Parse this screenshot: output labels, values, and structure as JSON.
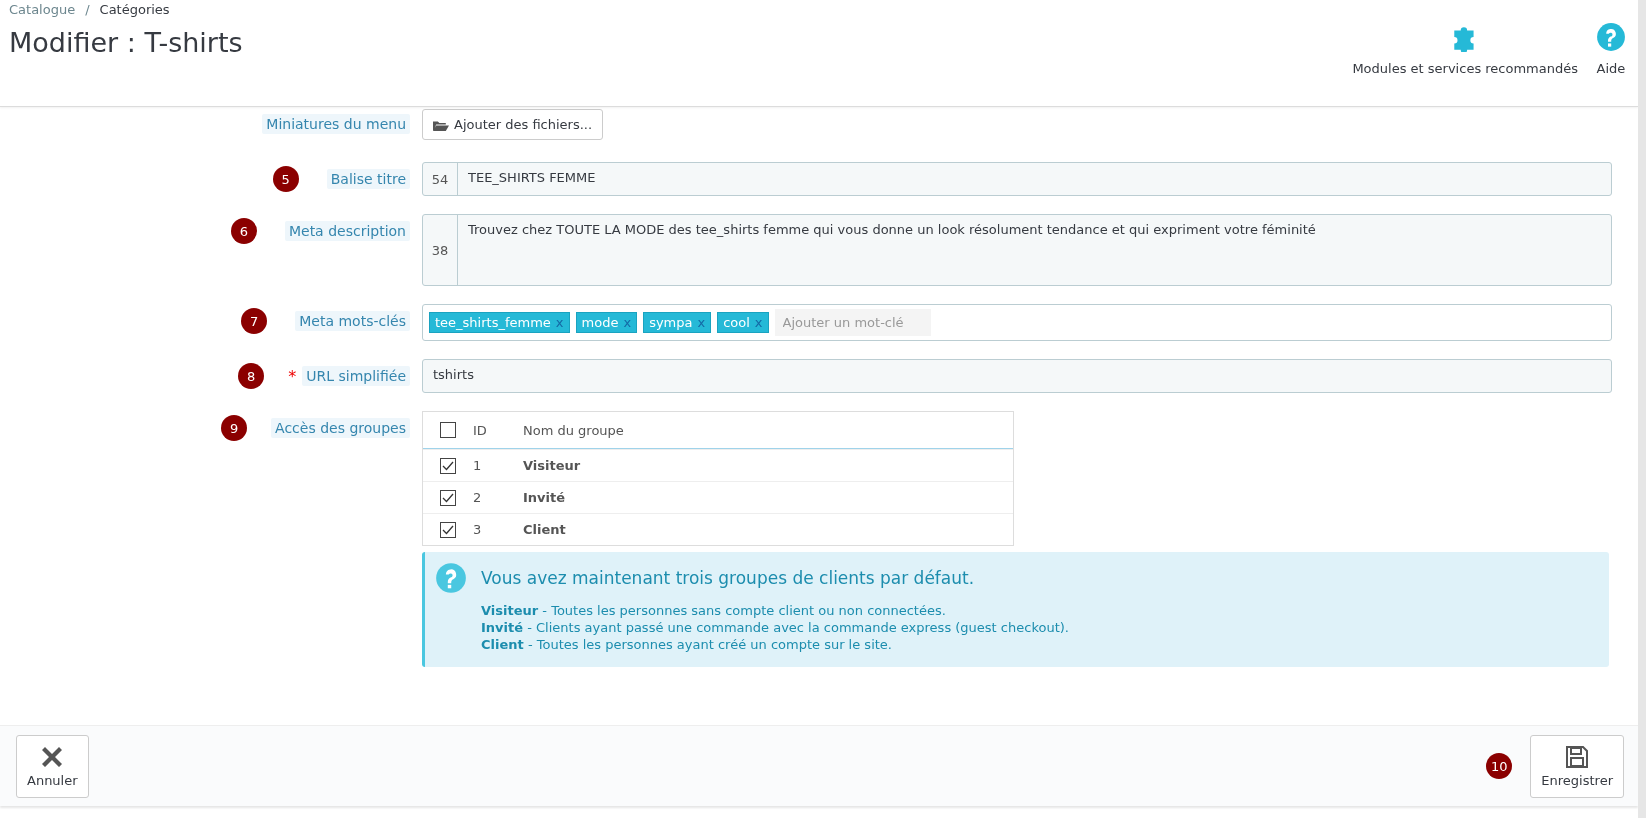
{
  "breadcrumb": [
    "Catalogue",
    "Catégories"
  ],
  "breadcrumb_separator": "/",
  "title": "Modifier : T-shirts",
  "toolbar": [
    {
      "kind": "modules",
      "label": "Modules et services recommandés"
    },
    {
      "kind": "help",
      "label": "Aide"
    }
  ],
  "form": [
    {
      "kind": "file",
      "label": "Miniatures du menu",
      "button": "Ajouter des fichiers..."
    },
    {
      "kind": "counted",
      "step": "5",
      "label": "Balise titre",
      "counter": "54",
      "value": "TEE_SHIRTS FEMME"
    },
    {
      "kind": "area",
      "step": "6",
      "label": "Meta description",
      "counter": "38",
      "value": "Trouvez chez TOUTE LA MODE des tee_shirts femme qui vous donne un look résolument tendance et qui expriment votre féminité"
    },
    {
      "kind": "tags",
      "step": "7",
      "label": "Meta mots-clés",
      "tags": [
        {
          "text": "tee_shirts_femme",
          "remove": "x"
        },
        {
          "text": "mode",
          "remove": "x"
        },
        {
          "text": "sympa",
          "remove": "x"
        },
        {
          "text": "cool",
          "remove": "x"
        }
      ],
      "placeholder": "Ajouter un mot-clé"
    },
    {
      "kind": "text",
      "step": "8",
      "required_mark": "*",
      "label": "URL simplifiée",
      "value": "tshirts"
    },
    {
      "kind": "groups",
      "step": "9",
      "label": "Accès des groupes",
      "all_checked": false,
      "columns": [
        "ID",
        "Nom du groupe"
      ],
      "rows": [
        {
          "id": "1",
          "name": "Visiteur",
          "checked": true
        },
        {
          "id": "2",
          "name": "Invité",
          "checked": true
        },
        {
          "id": "3",
          "name": "Client",
          "checked": true
        }
      ],
      "info": {
        "title": "Vous avez maintenant trois groupes de clients par défaut.",
        "lines": [
          "**Visiteur** - Toutes les personnes sans compte client ou non connectées.",
          "**Invité** - Clients ayant passé une commande avec la commande express (guest checkout).",
          "**Client** - Toutes les personnes ayant créé un compte sur le site."
        ]
      }
    }
  ],
  "footer": {
    "cancel": "Annuler",
    "save_step": "10",
    "save": "Enregistrer"
  }
}
